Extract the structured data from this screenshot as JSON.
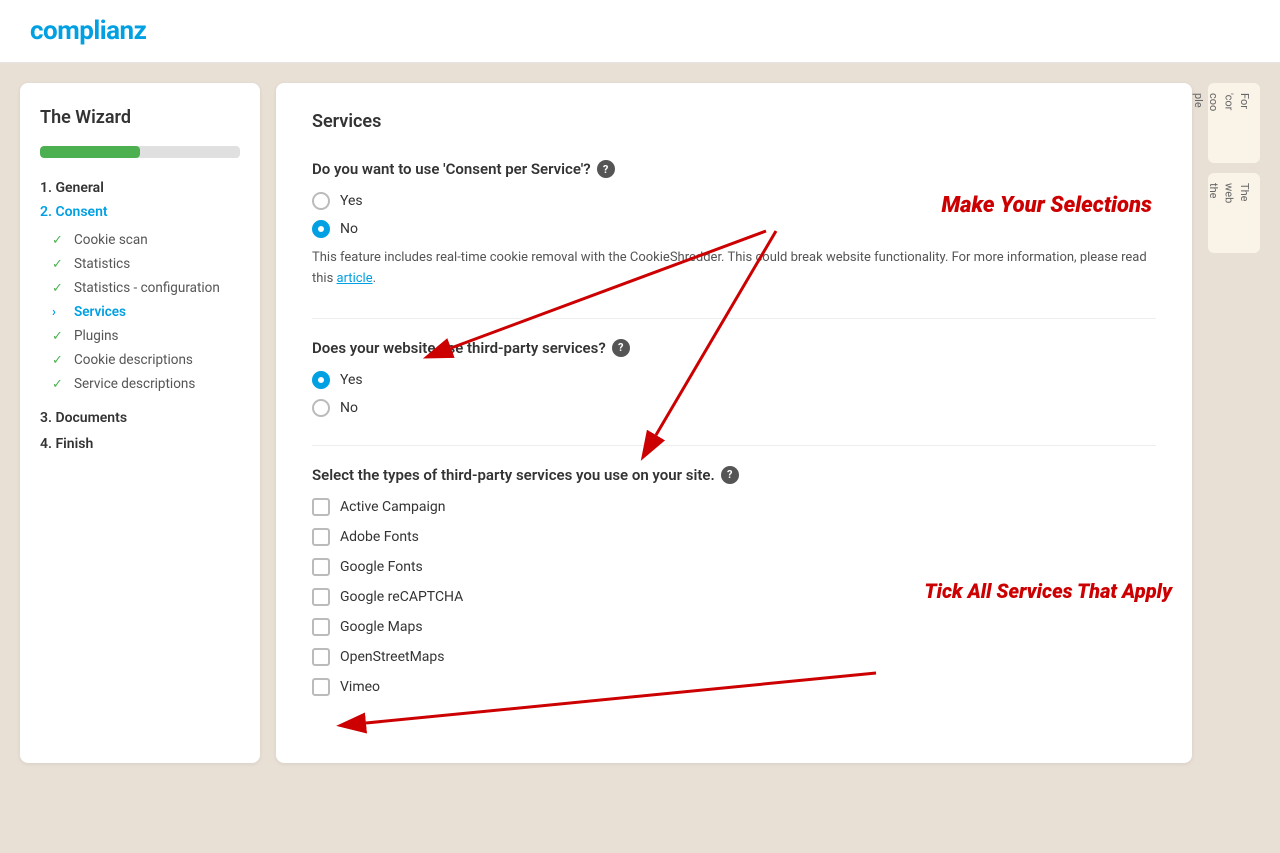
{
  "header": {
    "logo": "complianz"
  },
  "sidebar": {
    "title": "The Wizard",
    "progress_percent": 50,
    "sections": [
      {
        "label": "1. General",
        "type": "section-label"
      },
      {
        "label": "2. Consent",
        "type": "section-label",
        "active": true
      },
      {
        "label": "Cookie scan",
        "type": "nav-item",
        "status": "checked"
      },
      {
        "label": "Statistics",
        "type": "nav-item",
        "status": "checked"
      },
      {
        "label": "Statistics - configuration",
        "type": "nav-item",
        "status": "checked"
      },
      {
        "label": "Services",
        "type": "nav-item",
        "status": "current"
      },
      {
        "label": "Plugins",
        "type": "nav-item",
        "status": "checked"
      },
      {
        "label": "Cookie descriptions",
        "type": "nav-item",
        "status": "checked"
      },
      {
        "label": "Service descriptions",
        "type": "nav-item",
        "status": "checked"
      },
      {
        "label": "3. Documents",
        "type": "section-label"
      },
      {
        "label": "4. Finish",
        "type": "section-label"
      }
    ]
  },
  "main": {
    "section_title": "Services",
    "questions": [
      {
        "id": "consent_per_service",
        "label": "Do you want to use 'Consent per Service'?",
        "has_help": true,
        "options": [
          {
            "value": "yes",
            "label": "Yes",
            "checked": false
          },
          {
            "value": "no",
            "label": "No",
            "checked": true
          }
        ],
        "info_text": "This feature includes real-time cookie removal with the CookieShredder. This could break website functionality. For more information, please read this",
        "info_link_text": "article",
        "info_link_suffix": "."
      },
      {
        "id": "third_party_services",
        "label": "Does your website use third-party services?",
        "has_help": true,
        "options": [
          {
            "value": "yes",
            "label": "Yes",
            "checked": true
          },
          {
            "value": "no",
            "label": "No",
            "checked": false
          }
        ]
      },
      {
        "id": "service_types",
        "label": "Select the types of third-party services you use on your site.",
        "has_help": true,
        "checkboxes": [
          {
            "value": "active_campaign",
            "label": "Active Campaign",
            "checked": false
          },
          {
            "value": "adobe_fonts",
            "label": "Adobe Fonts",
            "checked": false
          },
          {
            "value": "google_fonts",
            "label": "Google Fonts",
            "checked": false
          },
          {
            "value": "google_recaptcha",
            "label": "Google reCAPTCHA",
            "checked": false
          },
          {
            "value": "google_maps",
            "label": "Google Maps",
            "checked": false
          },
          {
            "value": "openstreetmaps",
            "label": "OpenStreetMaps",
            "checked": false
          },
          {
            "value": "vimeo",
            "label": "Vimeo",
            "checked": false
          }
        ]
      }
    ]
  },
  "annotations": {
    "make_selections": "Make Your Selections",
    "tick_services": "Tick All Services That Apply"
  },
  "right_panel": {
    "cards": [
      {
        "text": "For 'cor coo ple"
      },
      {
        "text": "The web the"
      }
    ]
  }
}
